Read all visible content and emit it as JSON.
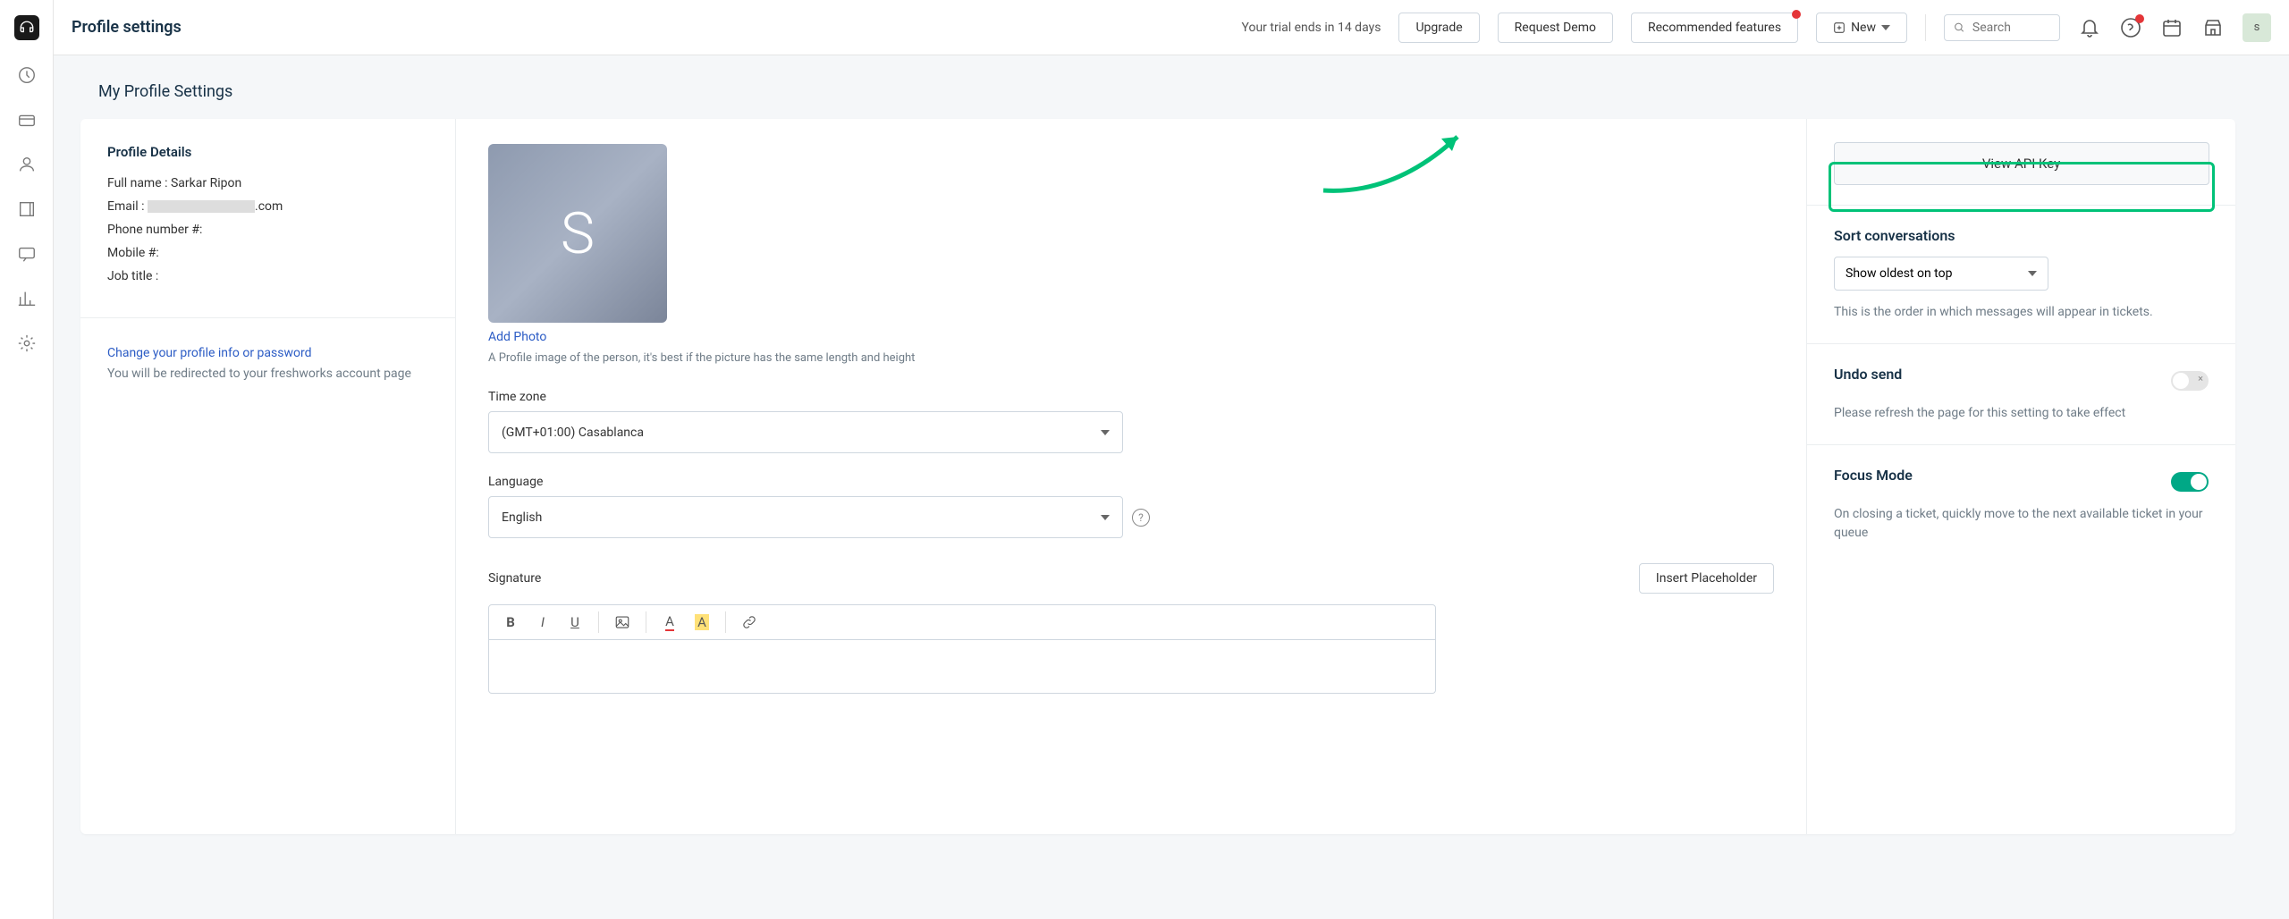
{
  "header": {
    "title": "Profile settings",
    "trial": "Your trial ends in 14 days",
    "upgrade": "Upgrade",
    "request_demo": "Request Demo",
    "recommended": "Recommended features",
    "new": "New",
    "search_placeholder": "Search",
    "avatar_initial": "s"
  },
  "content": {
    "heading": "My Profile Settings"
  },
  "profile": {
    "section_title": "Profile Details",
    "fullname_label": "Full name : ",
    "fullname_value": "Sarkar Ripon",
    "email_label": "Email : ",
    "email_suffix": ".com",
    "phone_label": "Phone number #:",
    "mobile_label": "Mobile #:",
    "job_label": "Job title :",
    "change_link": "Change your profile info or password",
    "change_desc": "You will be redirected to your freshworks account page"
  },
  "photo": {
    "initial": "S",
    "add": "Add Photo",
    "desc": "A Profile image of the person, it's best if the picture has the same length and height"
  },
  "timezone": {
    "label": "Time zone",
    "value": "(GMT+01:00) Casablanca"
  },
  "language": {
    "label": "Language",
    "value": "English"
  },
  "signature": {
    "label": "Signature",
    "insert": "Insert Placeholder"
  },
  "api": {
    "button": "View API Key"
  },
  "sort": {
    "title": "Sort conversations",
    "value": "Show oldest on top",
    "desc": "This is the order in which messages will appear in tickets."
  },
  "undo": {
    "title": "Undo send",
    "desc": "Please refresh the page for this setting to take effect"
  },
  "focus": {
    "title": "Focus Mode",
    "desc": "On closing a ticket, quickly move to the next available ticket in your queue"
  }
}
